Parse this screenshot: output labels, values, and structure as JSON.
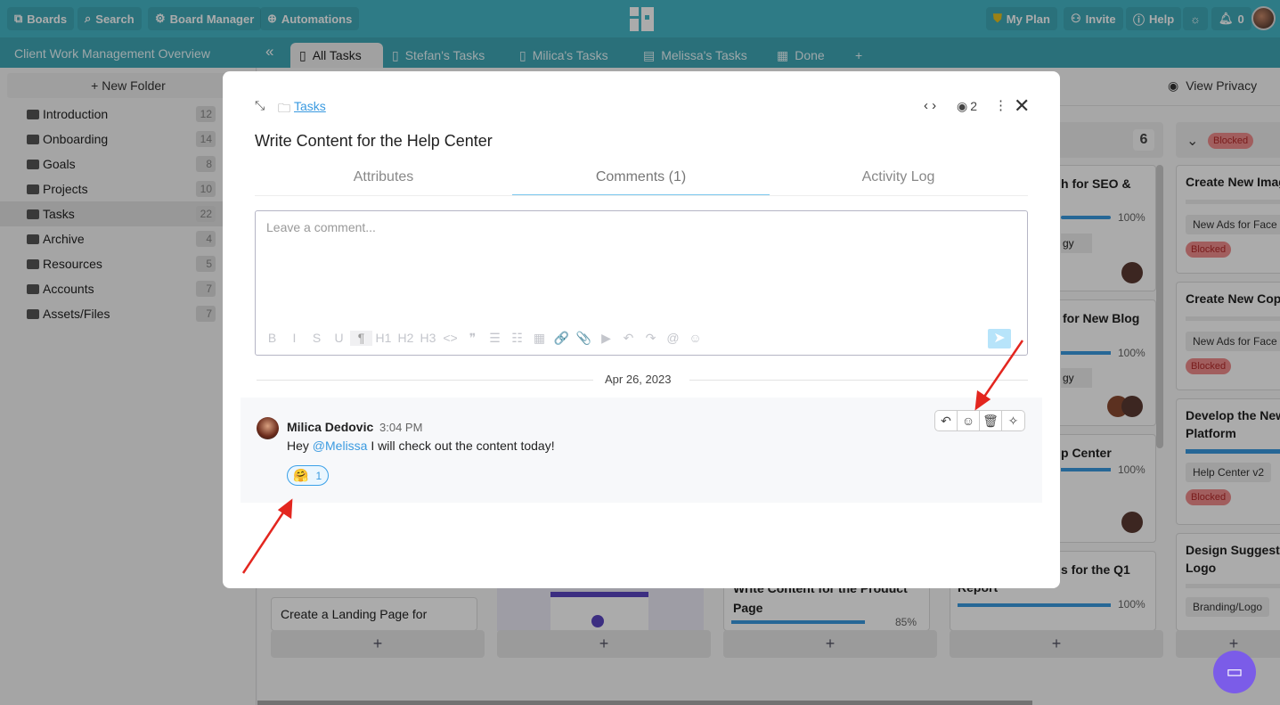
{
  "topbar": {
    "boards": "Boards",
    "search": "Search",
    "board_manager": "Board Manager",
    "automations": "Automations",
    "my_plan": "My Plan",
    "invite": "Invite",
    "help": "Help",
    "notifications": "0"
  },
  "board": {
    "title": "Client Work Management Overview",
    "tabs": [
      "All Tasks",
      "Stefan's Tasks",
      "Milica's Tasks",
      "Melissa's Tasks",
      "Done"
    ],
    "add_tab": "+",
    "view_privacy": "View Privacy"
  },
  "sidebar": {
    "new_folder": "+ New Folder",
    "items": [
      {
        "label": "Introduction",
        "count": "12"
      },
      {
        "label": "Onboarding",
        "count": "14"
      },
      {
        "label": "Goals",
        "count": "8"
      },
      {
        "label": "Projects",
        "count": "10"
      },
      {
        "label": "Tasks",
        "count": "22"
      },
      {
        "label": "Archive",
        "count": "4"
      },
      {
        "label": "Resources",
        "count": "5"
      },
      {
        "label": "Accounts",
        "count": "7"
      },
      {
        "label": "Assets/Files",
        "count": "7"
      }
    ]
  },
  "columns": {
    "col4_count": "6",
    "col5_status": "Blocked"
  },
  "cards": {
    "c4a": {
      "title": "h for SEO &",
      "progress": "100%",
      "tag": "gy"
    },
    "c4b": {
      "title": "for New Blog",
      "progress": "100%",
      "tag": "gy"
    },
    "c4c": {
      "title": "p Center",
      "progress": "100%"
    },
    "c4d": {
      "title": "s for the Q1",
      "title2": "Report",
      "progress": "100%"
    },
    "c5a": {
      "title": "Create New Imag",
      "tag": "New Ads for Face",
      "status": "Blocked"
    },
    "c5b": {
      "title": "Create New Cop",
      "tag": "New Ads for Face",
      "status": "Blocked"
    },
    "c5c": {
      "title": "Develop the New",
      "title2": "Platform",
      "tag": "Help Center v2",
      "status": "Blocked"
    },
    "c5d": {
      "title": "Design Suggesti",
      "title2": "Logo",
      "tag": "Branding/Logo"
    },
    "c1": {
      "title": "Create a Landing Page for"
    },
    "c3": {
      "title": "Write Content for the Product",
      "title2": "Page",
      "progress": "85%"
    }
  },
  "add_card": "+",
  "modal": {
    "breadcrumb": "Tasks",
    "title": "Write Content for the Help Center",
    "watchers": "2",
    "tabs": [
      "Attributes",
      "Comments (1)",
      "Activity Log"
    ],
    "active_tab": 1,
    "comment_placeholder": "Leave a comment...",
    "toolbar": [
      "B",
      "I",
      "S",
      "U",
      "¶",
      "H1",
      "H2",
      "H3",
      "<>",
      "❞",
      "☰",
      "☷",
      "▦",
      "🔗",
      "📎",
      "▶",
      "↶",
      "↷",
      "@",
      "☺"
    ],
    "date": "Apr 26, 2023",
    "comment": {
      "author": "Milica Dedovic",
      "time": "3:04 PM",
      "text_before": "Hey ",
      "mention": "@Melissa",
      "text_after": " I will check out the content today!",
      "reaction_emoji": "🤗",
      "reaction_count": "1"
    }
  },
  "colors": {
    "brand": "#45b8c8",
    "accent": "#3aa0e8",
    "blocked": "#f08c8c",
    "annotation": "#e3261f"
  }
}
